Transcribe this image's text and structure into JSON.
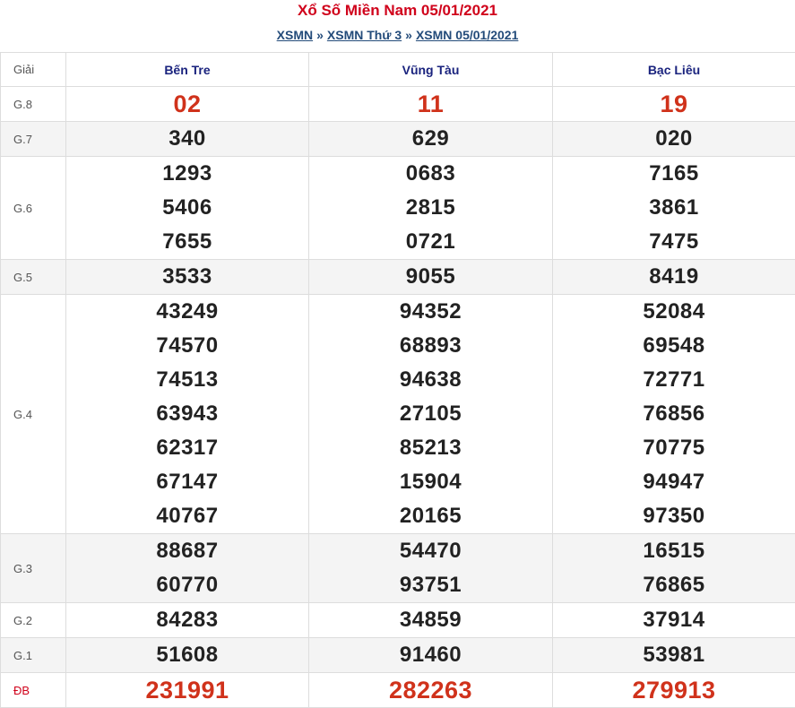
{
  "header": {
    "title": "Xổ Số Miền Nam 05/01/2021",
    "breadcrumb": [
      {
        "label": "XSMN"
      },
      {
        "label": "XSMN Thứ 3"
      },
      {
        "label": "XSMN 05/01/2021"
      }
    ],
    "separator": "»"
  },
  "table": {
    "label_header": "Giải",
    "provinces": [
      "Bến Tre",
      "Vũng Tàu",
      "Bạc Liêu"
    ],
    "rows": [
      {
        "label": "G.8",
        "alt": false,
        "red": true,
        "special": false,
        "values": [
          [
            "02"
          ],
          [
            "11"
          ],
          [
            "19"
          ]
        ]
      },
      {
        "label": "G.7",
        "alt": true,
        "red": false,
        "special": false,
        "values": [
          [
            "340"
          ],
          [
            "629"
          ],
          [
            "020"
          ]
        ]
      },
      {
        "label": "G.6",
        "alt": false,
        "red": false,
        "special": false,
        "values": [
          [
            "1293",
            "5406",
            "7655"
          ],
          [
            "0683",
            "2815",
            "0721"
          ],
          [
            "7165",
            "3861",
            "7475"
          ]
        ]
      },
      {
        "label": "G.5",
        "alt": true,
        "red": false,
        "special": false,
        "values": [
          [
            "3533"
          ],
          [
            "9055"
          ],
          [
            "8419"
          ]
        ]
      },
      {
        "label": "G.4",
        "alt": false,
        "red": false,
        "special": false,
        "values": [
          [
            "43249",
            "74570",
            "74513",
            "63943",
            "62317",
            "67147",
            "40767"
          ],
          [
            "94352",
            "68893",
            "94638",
            "27105",
            "85213",
            "15904",
            "20165"
          ],
          [
            "52084",
            "69548",
            "72771",
            "76856",
            "70775",
            "94947",
            "97350"
          ]
        ]
      },
      {
        "label": "G.3",
        "alt": true,
        "red": false,
        "special": false,
        "values": [
          [
            "88687",
            "60770"
          ],
          [
            "54470",
            "93751"
          ],
          [
            "16515",
            "76865"
          ]
        ]
      },
      {
        "label": "G.2",
        "alt": false,
        "red": false,
        "special": false,
        "values": [
          [
            "84283"
          ],
          [
            "34859"
          ],
          [
            "37914"
          ]
        ]
      },
      {
        "label": "G.1",
        "alt": true,
        "red": false,
        "special": false,
        "values": [
          [
            "51608"
          ],
          [
            "91460"
          ],
          [
            "53981"
          ]
        ]
      },
      {
        "label": "ĐB",
        "alt": false,
        "red": true,
        "special": true,
        "values": [
          [
            "231991"
          ],
          [
            "282263"
          ],
          [
            "279913"
          ]
        ]
      }
    ]
  }
}
